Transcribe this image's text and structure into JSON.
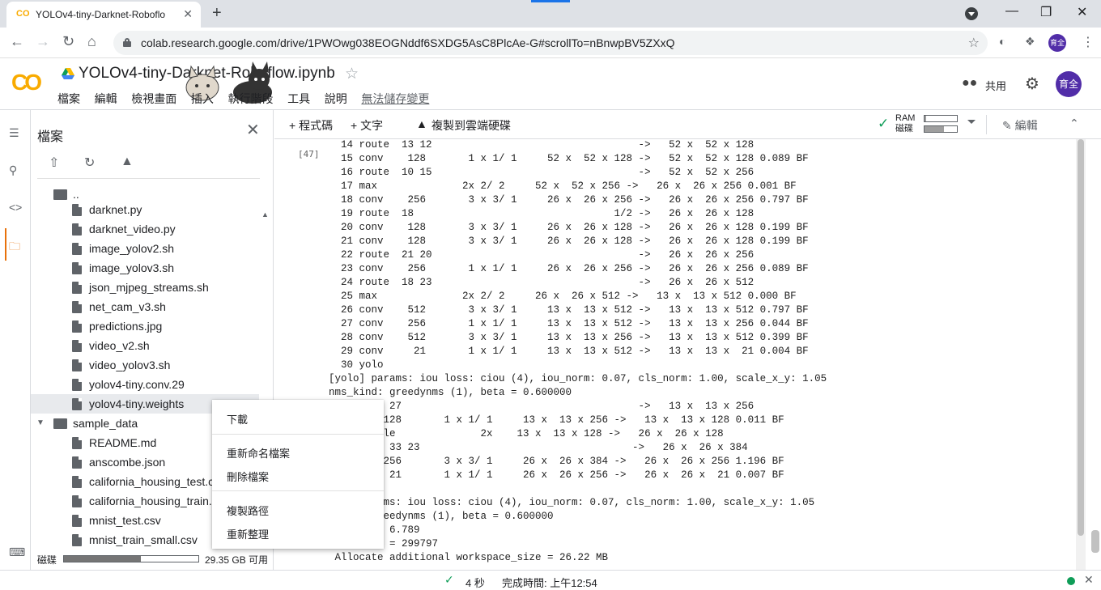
{
  "browser": {
    "tab_title": "YOLOv4-tiny-Darknet-Roboflo",
    "tab_favicon": "CO",
    "tab_close": "✕",
    "new_tab": "+",
    "url": "colab.research.google.com/drive/1PWOwg038EOGNddf6SXDG5AsC8PlcAe-G#scrollTo=nBnwpBV5ZXxQ",
    "profile_initials": "育全",
    "window_controls": {
      "minimize": "—",
      "restore": "❐",
      "close": "✕"
    }
  },
  "colab": {
    "notebook_title": "YOLOv4-tiny-Darknet-Roboflow.ipynb",
    "menu": [
      "檔案",
      "編輯",
      "檢視畫面",
      "插入",
      "執行階段",
      "工具",
      "說明"
    ],
    "unsaved_label": "無法儲存變更",
    "share_label": "共用",
    "user_initials": "育全"
  },
  "files_panel": {
    "title": "檔案",
    "parent_dir": "..",
    "items": [
      {
        "name": "darknet.py",
        "type": "file"
      },
      {
        "name": "darknet_video.py",
        "type": "file"
      },
      {
        "name": "image_yolov2.sh",
        "type": "file"
      },
      {
        "name": "image_yolov3.sh",
        "type": "file"
      },
      {
        "name": "json_mjpeg_streams.sh",
        "type": "file"
      },
      {
        "name": "net_cam_v3.sh",
        "type": "file"
      },
      {
        "name": "predictions.jpg",
        "type": "file"
      },
      {
        "name": "video_v2.sh",
        "type": "file"
      },
      {
        "name": "video_yolov3.sh",
        "type": "file"
      },
      {
        "name": "yolov4-tiny.conv.29",
        "type": "file"
      },
      {
        "name": "yolov4-tiny.weights",
        "type": "file",
        "selected": true
      },
      {
        "name": "sample_data",
        "type": "folder"
      },
      {
        "name": "README.md",
        "type": "file"
      },
      {
        "name": "anscombe.json",
        "type": "file"
      },
      {
        "name": "california_housing_test.csv",
        "type": "file"
      },
      {
        "name": "california_housing_train.csv",
        "type": "file"
      },
      {
        "name": "mnist_test.csv",
        "type": "file"
      },
      {
        "name": "mnist_train_small.csv",
        "type": "file"
      }
    ],
    "disk_label": "磁碟",
    "disk_used_fraction": 0.57,
    "disk_free": "29.35 GB 可用"
  },
  "notebook_toolbar": {
    "add_code": "+ 程式碼",
    "add_text": "+ 文字",
    "copy_to_drive": "複製到雲端硬碟",
    "ram_label": "RAM",
    "disk_label": "磁碟",
    "ram_fraction": 0.05,
    "disk_fraction": 0.6,
    "edit_label": "編輯"
  },
  "output": {
    "exec_count": "[47]",
    "lines": [
      "  14 route  13 12                                  ->   52 x  52 x 128",
      "  15 conv    128       1 x 1/ 1     52 x  52 x 128 ->   52 x  52 x 128 0.089 BF",
      "  16 route  10 15                                  ->   52 x  52 x 256",
      "  17 max              2x 2/ 2     52 x  52 x 256 ->   26 x  26 x 256 0.001 BF",
      "  18 conv    256       3 x 3/ 1     26 x  26 x 256 ->   26 x  26 x 256 0.797 BF",
      "  19 route  18                                 1/2 ->   26 x  26 x 128",
      "  20 conv    128       3 x 3/ 1     26 x  26 x 128 ->   26 x  26 x 128 0.199 BF",
      "  21 conv    128       3 x 3/ 1     26 x  26 x 128 ->   26 x  26 x 128 0.199 BF",
      "  22 route  21 20                                  ->   26 x  26 x 256",
      "  23 conv    256       1 x 1/ 1     26 x  26 x 256 ->   26 x  26 x 256 0.089 BF",
      "  24 route  18 23                                  ->   26 x  26 x 512",
      "  25 max              2x 2/ 2     26 x  26 x 512 ->   13 x  13 x 512 0.000 BF",
      "  26 conv    512       3 x 3/ 1     13 x  13 x 512 ->   13 x  13 x 512 0.797 BF",
      "  27 conv    256       1 x 1/ 1     13 x  13 x 512 ->   13 x  13 x 256 0.044 BF",
      "  28 conv    512       3 x 3/ 1     13 x  13 x 256 ->   13 x  13 x 512 0.399 BF",
      "  29 conv     21       1 x 1/ 1     13 x  13 x 512 ->   13 x  13 x  21 0.004 BF",
      "  30 yolo",
      "[yolo] params: iou loss: ciou (4), iou_norm: 0.07, cls_norm: 1.00, scale_x_y: 1.05",
      "nms_kind: greedynms (1), beta = 0.600000",
      "       e  27                                       ->   13 x  13 x 256",
      "         128       1 x 1/ 1     13 x  13 x 256 ->   13 x  13 x 128 0.011 BF",
      "       mple              2x    13 x  13 x 128 ->   26 x  26 x 128",
      "       e  33 23                                   ->   26 x  26 x 384",
      "         256       3 x 3/ 1     26 x  26 x 384 ->   26 x  26 x 256 1.196 BF",
      "          21       1 x 1/ 1     26 x  26 x 256 ->   26 x  26 x  21 0.007 BF",
      "",
      "      arams: iou loss: ciou (4), iou_norm: 0.07, cls_norm: 1.00, scale_x_y: 1.05",
      "       greedynms (1), beta = 0.600000",
      "      OPS 6.789",
      "       ts = 299797",
      " Allocate additional workspace_size = 26.22 MB"
    ]
  },
  "context_menu": {
    "download": "下載",
    "rename": "重新命名檔案",
    "delete": "刪除檔案",
    "copy_path": "複製路徑",
    "refresh": "重新整理"
  },
  "status_bar": {
    "duration": "4 秒",
    "completed": "完成時間: 上午12:54"
  }
}
